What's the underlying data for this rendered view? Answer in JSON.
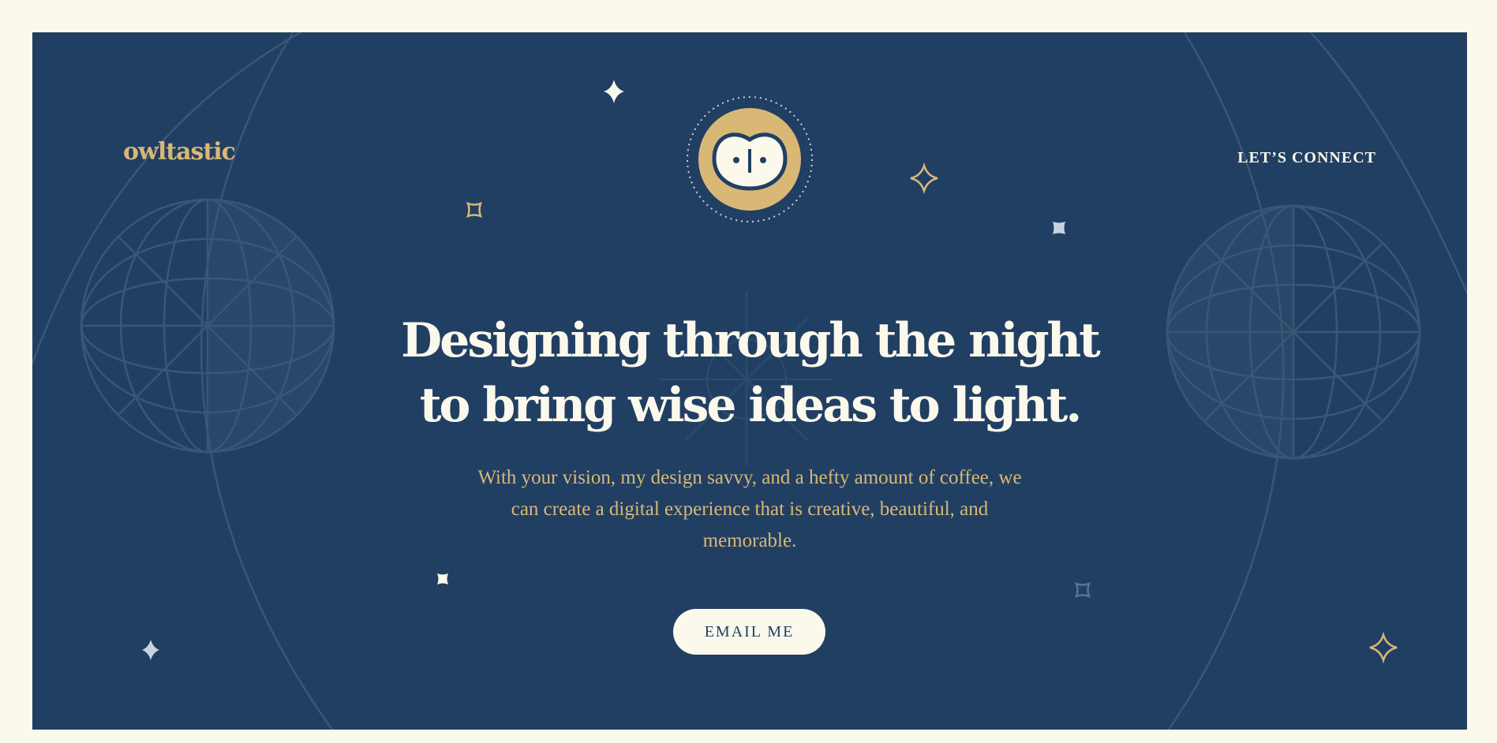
{
  "header": {
    "logo_text": "owltastic",
    "nav_link": "LET’S CONNECT"
  },
  "hero": {
    "headline_line1": "Designing through the night",
    "headline_line2": "to bring wise ideas to light.",
    "subtext": "With your vision, my design savvy, and a hefty amount of coffee, we can create a digital experience that is creative, beautiful, and memorable.",
    "cta_label": "EMAIL ME"
  },
  "icons": {
    "badge": "owl-face-icon",
    "stars": "sparkle-star-icon",
    "background": "celestial-globe-illustration"
  },
  "colors": {
    "page_background": "#fbf8ec",
    "hero_background": "#213f63",
    "accent_gold": "#d9b876",
    "cream_text": "#fbf8ec",
    "illustration_lines": "#3c5a78"
  }
}
